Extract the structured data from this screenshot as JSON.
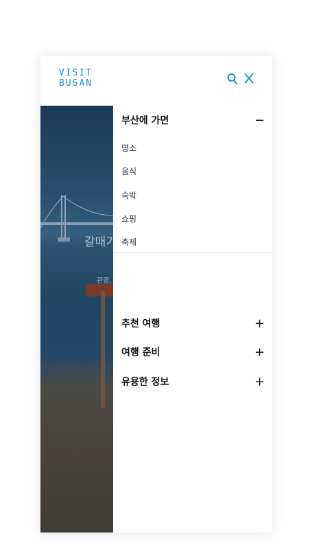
{
  "logo": {
    "line1": "VISIT",
    "line2": "BUSAN",
    "color": "#1a8fc9"
  },
  "header": {
    "icons": [
      "search-icon",
      "close-icon"
    ]
  },
  "hero": {
    "title": "갈매기",
    "subtitle": "관광,"
  },
  "menu": {
    "sections": [
      {
        "label": "부산에 가면",
        "toggle": "−",
        "expanded": true,
        "items": [
          "명소",
          "음식",
          "숙박",
          "쇼핑",
          "축제"
        ]
      },
      {
        "label": "추천 여행",
        "toggle": "+",
        "expanded": false
      },
      {
        "label": "여행 준비",
        "toggle": "+",
        "expanded": false
      },
      {
        "label": "유용한 정보",
        "toggle": "+",
        "expanded": false
      }
    ]
  }
}
